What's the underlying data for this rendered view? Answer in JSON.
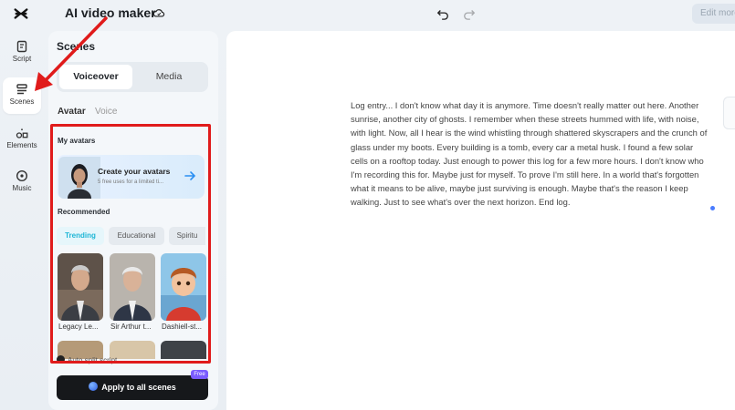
{
  "app": {
    "title": "AI video maker",
    "edit_more_label": "Edit more"
  },
  "rail": {
    "items": [
      {
        "label": "Script",
        "icon": "script-icon"
      },
      {
        "label": "Scenes",
        "icon": "scenes-icon",
        "active": true
      },
      {
        "label": "Elements",
        "icon": "elements-icon"
      },
      {
        "label": "Music",
        "icon": "music-icon"
      }
    ]
  },
  "scenes_panel": {
    "title": "Scenes",
    "segments": {
      "on": "Voiceover",
      "off": "Media"
    },
    "subtabs": {
      "avatar": "Avatar",
      "voice": "Voice"
    },
    "my_avatars_label": "My avatars",
    "create_card": {
      "title": "Create your avatars",
      "subtitle": "5 free uses for a limited ti..."
    },
    "recommended_label": "Recommended",
    "chips": [
      "Trending",
      "Educational",
      "Spiritu"
    ],
    "avatars": [
      {
        "name": "Legacy Le..."
      },
      {
        "name": "Sir Arthur t..."
      },
      {
        "name": "Dashiell-st..."
      }
    ],
    "auto_split_label": "Auto split script",
    "apply_button": "Apply to all scenes",
    "free_badge": "Free"
  },
  "editor": {
    "script_text": "Log entry... I don't know what day it is anymore. Time doesn't really matter out here. Another sunrise, another city of ghosts. I remember when these streets hummed with life, with noise, with light. Now, all I hear is the wind whistling through shattered skyscrapers and the crunch of glass under my boots. Every building is a tomb, every car a metal husk. I found a few solar cells on a rooftop today. Just enough to power this log for a few more hours. I don't know who I'm recording this for. Maybe just for myself. To prove I'm still here. In a world that's forgotten what it means to be alive, maybe just surviving is enough. Maybe that's the reason I keep walking. Just to see what's over the next horizon. End log."
  },
  "colors": {
    "annotation_red": "#e01b1b",
    "accent_cyan": "#1eb6d6",
    "primary_dark": "#16181b"
  }
}
